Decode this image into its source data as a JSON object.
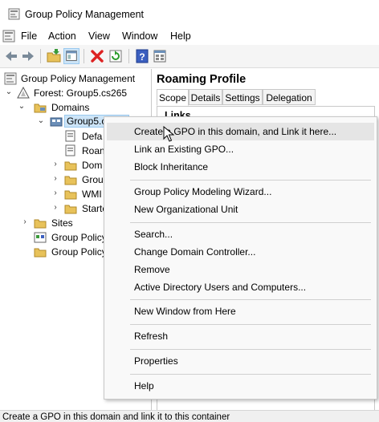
{
  "window": {
    "title": "Group Policy Management"
  },
  "menubar": {
    "items": [
      "File",
      "Action",
      "View",
      "Window",
      "Help"
    ]
  },
  "toolbar": {
    "buttons": [
      "back-icon",
      "forward-icon",
      "folder-up-icon",
      "console-tree-icon",
      "delete-icon",
      "refresh-icon",
      "help-icon",
      "properties-icon"
    ]
  },
  "tree": {
    "root": "Group Policy Management",
    "forest": "Forest: Group5.cs265",
    "domains": "Domains",
    "domain": "Group5.cs265",
    "children": [
      "Defa",
      "Roan",
      "Dom",
      "Grou",
      "WMI",
      "Starte"
    ],
    "sites": "Sites",
    "modeling": "Group Policy",
    "results": "Group Policy"
  },
  "details": {
    "heading": "Roaming Profile",
    "tabs": [
      "Scope",
      "Details",
      "Settings",
      "Delegation"
    ],
    "active_tab": "Scope",
    "links_label": "Links",
    "partial_text": "<none>"
  },
  "context_menu": {
    "groups": [
      [
        "Create a GPO in this domain, and Link it here...",
        "Link an Existing GPO...",
        "Block Inheritance"
      ],
      [
        "Group Policy Modeling Wizard...",
        "New Organizational Unit"
      ],
      [
        "Search...",
        "Change Domain Controller...",
        "Remove",
        "Active Directory Users and Computers..."
      ],
      [
        "New Window from Here"
      ],
      [
        "Refresh"
      ],
      [
        "Properties"
      ],
      [
        "Help"
      ]
    ]
  },
  "status": {
    "text": "Create a GPO in this domain and link it to this container"
  },
  "colors": {
    "selection": "#cce4f7",
    "selection_border": "#99c9ef",
    "menu_bg": "#f9f9f9"
  }
}
